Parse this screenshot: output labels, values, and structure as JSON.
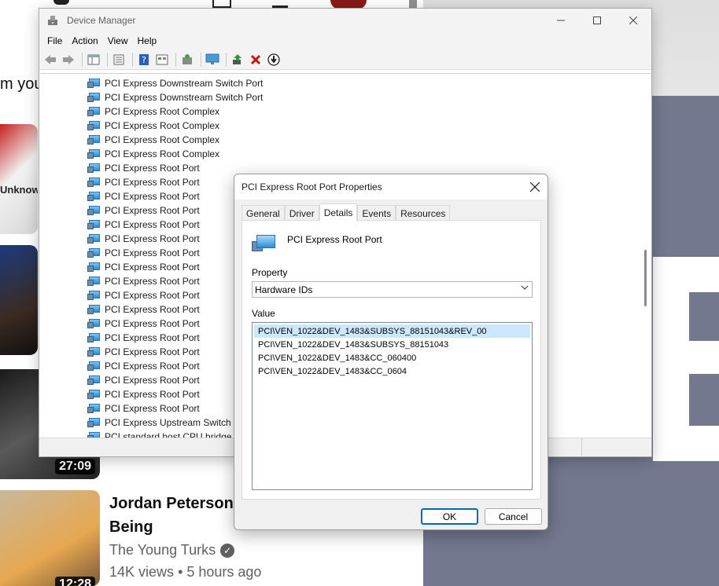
{
  "background": {
    "partial_text": "m you",
    "thumb1_text": "Unknow",
    "video_duration_1": "27:09",
    "video_duration_2": "12:28",
    "video_title": "Jordan Peterson Reaction To Being",
    "video_channel": "The Young Turks",
    "video_views": "14K views",
    "video_age": "5 hours ago"
  },
  "device_manager": {
    "title": "Device Manager",
    "menu": [
      "File",
      "Action",
      "View",
      "Help"
    ],
    "toolbar_icons": [
      "back-icon",
      "forward-icon",
      "properties-icon",
      "list-icon",
      "help-icon",
      "view-icon",
      "scan-icon",
      "monitor-icon",
      "enable-device-icon",
      "uninstall-icon",
      "update-driver-icon"
    ],
    "tree_items": [
      "PCI Express Downstream Switch Port",
      "PCI Express Downstream Switch Port",
      "PCI Express Root Complex",
      "PCI Express Root Complex",
      "PCI Express Root Complex",
      "PCI Express Root Complex",
      "PCI Express Root Port",
      "PCI Express Root Port",
      "PCI Express Root Port",
      "PCI Express Root Port",
      "PCI Express Root Port",
      "PCI Express Root Port",
      "PCI Express Root Port",
      "PCI Express Root Port",
      "PCI Express Root Port",
      "PCI Express Root Port",
      "PCI Express Root Port",
      "PCI Express Root Port",
      "PCI Express Root Port",
      "PCI Express Root Port",
      "PCI Express Root Port",
      "PCI Express Root Port",
      "PCI Express Root Port",
      "PCI Express Root Port",
      "PCI Express Upstream Switch Port",
      "PCI standard host CPU bridge"
    ]
  },
  "properties_dialog": {
    "title": "PCI Express Root Port Properties",
    "tabs": [
      "General",
      "Driver",
      "Details",
      "Events",
      "Resources"
    ],
    "active_tab": "Details",
    "device_name": "PCI Express Root Port",
    "property_label": "Property",
    "property_selected": "Hardware IDs",
    "value_label": "Value",
    "values": [
      "PCI\\VEN_1022&DEV_1483&SUBSYS_88151043&REV_00",
      "PCI\\VEN_1022&DEV_1483&SUBSYS_88151043",
      "PCI\\VEN_1022&DEV_1483&CC_060400",
      "PCI\\VEN_1022&DEV_1483&CC_0604"
    ],
    "selected_value_index": 0,
    "ok_label": "OK",
    "cancel_label": "Cancel"
  }
}
